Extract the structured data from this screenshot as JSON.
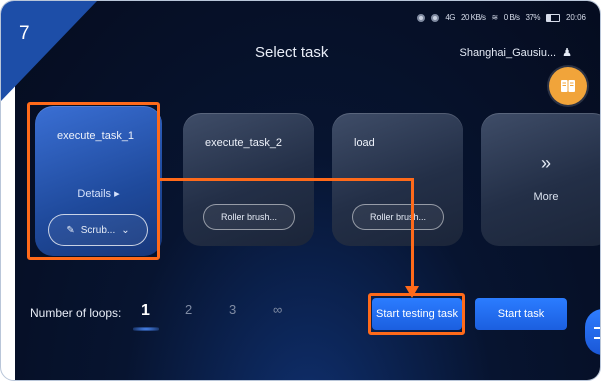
{
  "step_number": "7",
  "status_bar": {
    "network": "4G",
    "speed_1": "20 KB/s",
    "speed_2": "0 B/s",
    "battery": "37%",
    "time": "20:06"
  },
  "header": {
    "title": "Select task",
    "location": "Shanghai_Gausiu..."
  },
  "tasks": [
    {
      "name": "execute_task_1",
      "details": "Details",
      "mode": "Scrub...",
      "selected": true
    },
    {
      "name": "execute_task_2",
      "mode": "Roller brush...",
      "selected": false
    },
    {
      "name": "load",
      "mode": "Roller brush...",
      "selected": false
    }
  ],
  "more": {
    "arrows": "»",
    "label": "More"
  },
  "loops": {
    "label": "Number of loops:",
    "options": [
      "1",
      "2",
      "3",
      "∞"
    ],
    "selected": "1"
  },
  "buttons": {
    "start_testing": "Start testing task",
    "start": "Start task"
  },
  "colors": {
    "accent": "#1f6bff",
    "highlight": "#ff6a1a",
    "book_button": "#f1a43a"
  },
  "icons": [
    "book-icon",
    "pencil-icon",
    "chevron-down-icon",
    "caret-right-icon",
    "double-chevron-right-icon",
    "menu-icon",
    "user-icon"
  ]
}
